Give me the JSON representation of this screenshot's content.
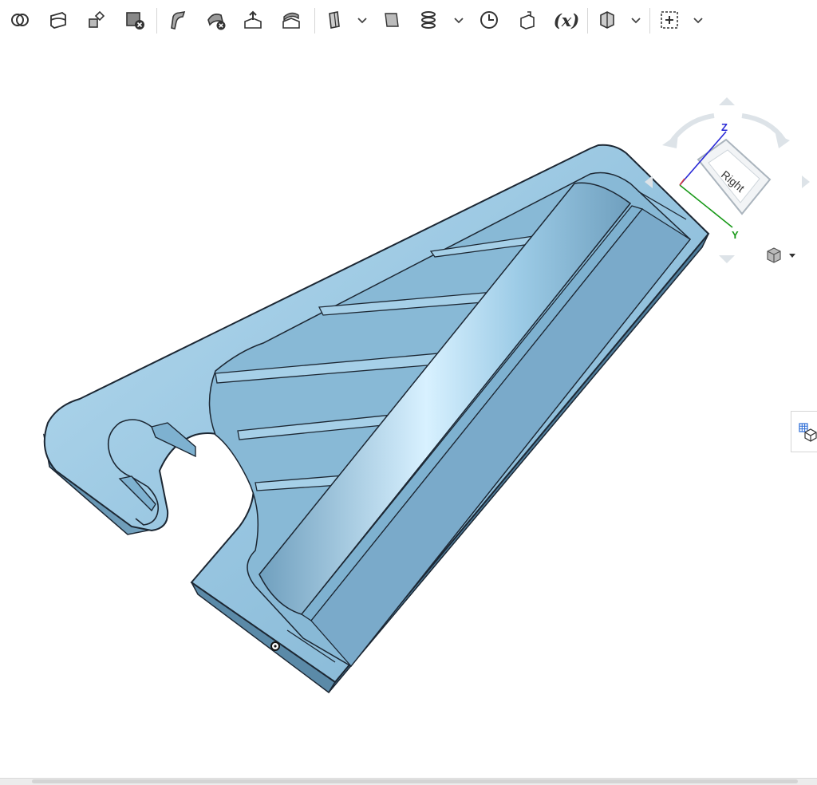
{
  "toolbar": {
    "tools": [
      {
        "name": "boolean-icon"
      },
      {
        "name": "split-icon"
      },
      {
        "name": "transform-icon"
      },
      {
        "name": "delete-part-icon"
      },
      {
        "name": "fillet-icon"
      },
      {
        "name": "delete-face-icon"
      },
      {
        "name": "move-face-icon"
      },
      {
        "name": "replace-face-icon"
      },
      {
        "name": "plane-icon"
      },
      {
        "name": "mate-connector-icon"
      },
      {
        "name": "helix-icon"
      },
      {
        "name": "measure-icon"
      },
      {
        "name": "section-icon"
      },
      {
        "name": "variable-icon",
        "label": "(x)"
      },
      {
        "name": "display-states-icon"
      },
      {
        "name": "add-custom-feature-icon"
      }
    ]
  },
  "viewcube": {
    "face_label": "Right",
    "axis_z": "Z",
    "axis_y": "Y"
  },
  "colors": {
    "part_fill": "#8fbfdc",
    "part_dark": "#5f8fad",
    "part_light": "#bfe2f5",
    "edge": "#1c2733",
    "axis_z": "#2a2ad6",
    "axis_y": "#1a9a1a",
    "axis_x": "#d63a3a"
  }
}
